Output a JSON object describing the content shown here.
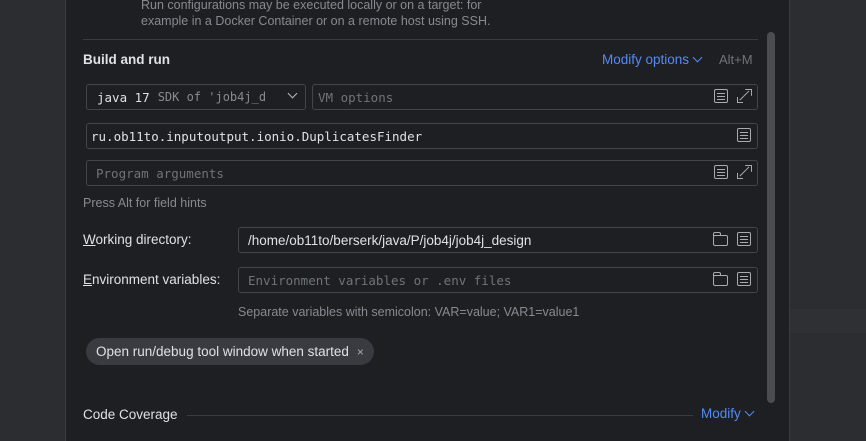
{
  "top_note": {
    "line1": "Run configurations may be executed locally or on a target: for",
    "line2": "example in a Docker Container or on a remote host using SSH."
  },
  "build_run": {
    "title": "Build and run",
    "modify_options": "Modify options",
    "modify_shortcut": "Alt+M",
    "sdk_value": "java 17",
    "sdk_desc": "SDK of 'job4j_d",
    "vm_placeholder": "VM options",
    "main_class": "ru.ob11to.inputoutput.ionio.DuplicatesFinder",
    "program_args_placeholder": "Program arguments",
    "hint": "Press Alt for field hints"
  },
  "working_directory": {
    "label_first": "W",
    "label_rest": "orking directory:",
    "value": "/home/ob11to/berserk/java/P/job4j/job4j_design"
  },
  "environment": {
    "label_first": "E",
    "label_rest": "nvironment variables:",
    "placeholder": "Environment variables or .env files",
    "hint": "Separate variables with semicolon: VAR=value; VAR1=value1"
  },
  "chip": {
    "label": "Open run/debug tool window when started",
    "close": "×"
  },
  "code_coverage": {
    "title": "Code Coverage",
    "modify": "Modify"
  }
}
